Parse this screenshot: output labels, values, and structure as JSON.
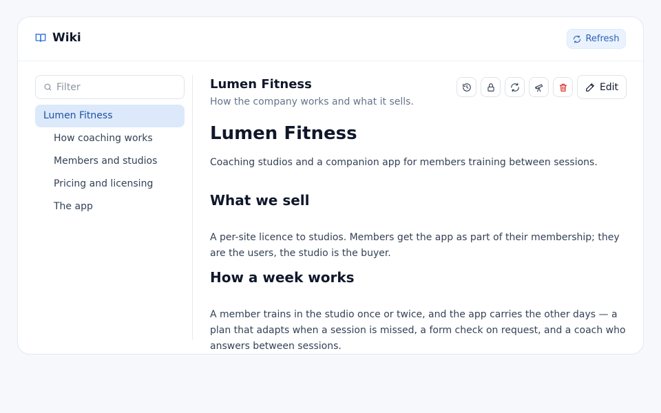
{
  "app": {
    "title": "Wiki",
    "refresh_label": "Refresh"
  },
  "sidebar": {
    "filter_placeholder": "Filter",
    "filter_value": "",
    "items": [
      {
        "label": "Lumen Fitness"
      },
      {
        "label": "How coaching works"
      },
      {
        "label": "Members and studios"
      },
      {
        "label": "Pricing and licensing"
      },
      {
        "label": "The app"
      }
    ]
  },
  "page": {
    "title": "Lumen Fitness",
    "subtitle": "How the company works and what it sells.",
    "edit_label": "Edit"
  },
  "toolbar": {
    "icons": [
      "history-icon",
      "lock-icon",
      "sync-icon",
      "telescope-icon",
      "trash-icon",
      "pencil-icon"
    ]
  },
  "doc": {
    "heading": "Lumen Fitness",
    "intro": "Coaching studios and a companion app for members training between sessions.",
    "sections": [
      {
        "heading": "What we sell",
        "body": "A per-site licence to studios. Members get the app as part of their membership; they are the users, the studio is the buyer."
      },
      {
        "heading": "How a week works",
        "body": "A member trains in the studio once or twice, and the app carries the other days — a plan that adapts when a session is missed, a form check on request, and a coach who answers between sessions."
      }
    ]
  },
  "colors": {
    "accent": "#2b5fb8",
    "selected_bg": "#dbe9fb",
    "danger": "#dc2626"
  }
}
